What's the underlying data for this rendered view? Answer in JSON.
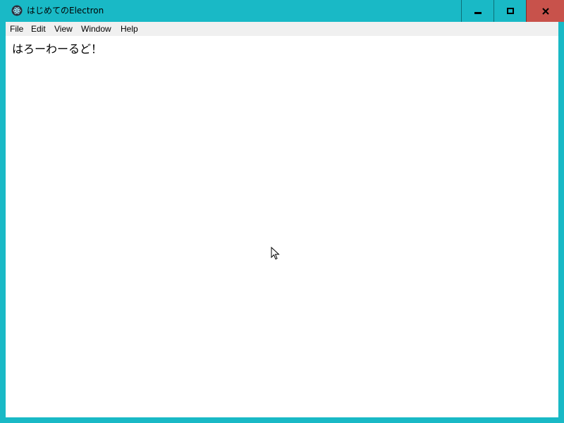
{
  "window": {
    "title": "はじめてのElectron",
    "app_icon": "electron-atom-icon",
    "controls": {
      "minimize_icon": "minimize-icon",
      "maximize_icon": "maximize-icon",
      "close_icon": "close-icon"
    }
  },
  "menu": {
    "items": [
      {
        "label": "File"
      },
      {
        "label": "Edit"
      },
      {
        "label": "View"
      },
      {
        "label": "Window"
      },
      {
        "label": "Help"
      }
    ]
  },
  "content": {
    "text": "はろーわーるど！"
  },
  "colors": {
    "frame": "#19b9c6",
    "close_button": "#c8524b",
    "menubar": "#f0f0f0",
    "content_bg": "#ffffff"
  }
}
